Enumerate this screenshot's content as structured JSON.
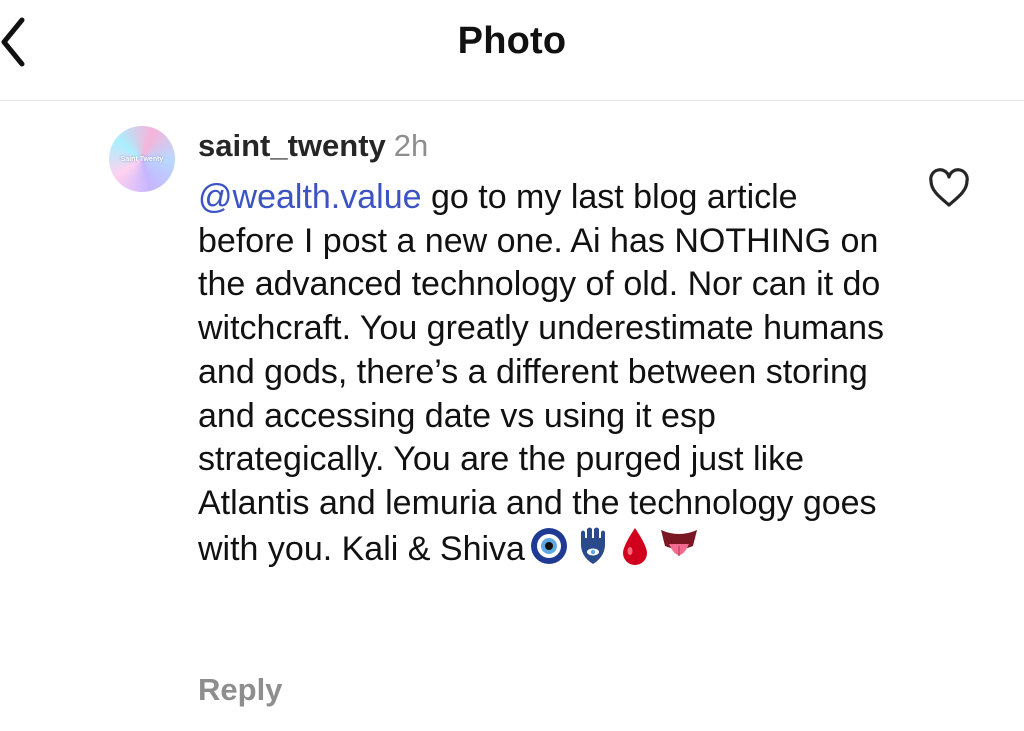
{
  "header": {
    "title": "Photo",
    "back_icon": "chevron-left-icon"
  },
  "comment": {
    "avatar_text": "Saint Twenty",
    "username": "saint_twenty",
    "timestamp": "2h",
    "mention": "@wealth.value",
    "text": " go to my last blog article before I post a new one. Ai has NOTHING on the advanced technology of old. Nor can it do witchcraft. You greatly underestimate humans and gods, there’s a different between storing and accessing date vs using it esp strategically. You are the purged just like Atlantis and lemuria and the technology goes with you. Kali & Shiva",
    "emojis": [
      "nazar-amulet-icon",
      "hamsa-icon",
      "blood-drop-icon",
      "tongue-out-icon"
    ],
    "like_icon": "heart-outline-icon",
    "reply_label": "Reply"
  },
  "colors": {
    "mention": "#3c53c4",
    "muted": "#8e8e8e",
    "text": "#111111"
  }
}
